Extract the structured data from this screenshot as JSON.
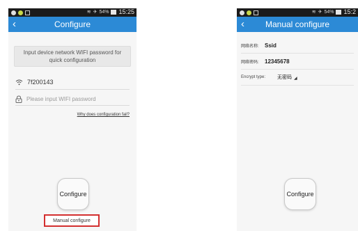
{
  "status_bar": {
    "battery": "54%",
    "time_left": "15:25",
    "time_right": "15:2"
  },
  "left_screen": {
    "title": "Configure",
    "instruction": "Input device network WIFI password for quick configuration",
    "wifi_name": "7f200143",
    "password_placeholder": "Please input WIFI password",
    "help_link": "Why does configuration fail?",
    "configure_button": "Configure",
    "manual_button": "Manual configure",
    "highlight_color": "#d32f2f"
  },
  "right_screen": {
    "title": "Manual configure",
    "ssid_label": "网络名称:",
    "ssid_value": "Ssid",
    "password_label": "网络密码:",
    "password_value": "12345678",
    "encrypt_label": "Encrypt type:",
    "encrypt_value": "无密码",
    "configure_button": "Configure"
  },
  "colors": {
    "title_bar": "#2c8ad6",
    "status_bar": "#1b1b1b",
    "background": "#f6f6f6"
  }
}
